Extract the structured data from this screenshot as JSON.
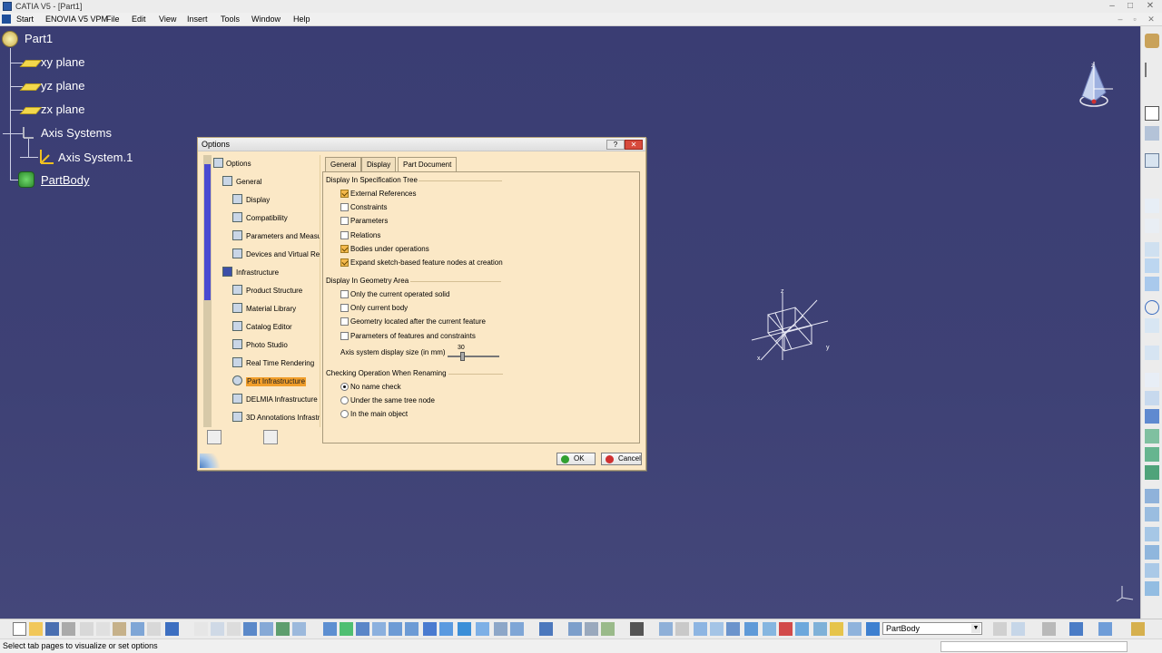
{
  "window": {
    "title": "CATIA V5 - [Part1]",
    "controls": [
      "–",
      "□",
      "✕"
    ]
  },
  "menu": [
    "Start",
    "ENOVIA V5 VPM",
    "File",
    "Edit",
    "View",
    "Insert",
    "Tools",
    "Window",
    "Help"
  ],
  "tree": {
    "root": "Part1",
    "xy_plane": "xy plane",
    "yz_plane": "yz plane",
    "zx_plane": "zx plane",
    "axis_systems": "Axis Systems",
    "axis_system_1": "Axis System.1",
    "part_body": "PartBody"
  },
  "dialog": {
    "title": "Options",
    "help_btn": "?",
    "close_btn": "✕",
    "tree": {
      "options": "Options",
      "general": "General",
      "display": "Display",
      "compatibility": "Compatibility",
      "parameters_measure": "Parameters and Measure",
      "devices": "Devices and Virtual Real",
      "infrastructure": "Infrastructure",
      "product_structure": "Product Structure",
      "material_library": "Material Library",
      "catalog_editor": "Catalog Editor",
      "photo_studio": "Photo Studio",
      "real_time_rendering": "Real Time Rendering",
      "part_infrastructure": "Part Infrastructure",
      "delmia": "DELMIA Infrastructure",
      "annotations_3d": "3D Annotations Infrastr"
    },
    "tabs": [
      "General",
      "Display",
      "Part Document"
    ],
    "spec_tree": {
      "title": "Display In Specification Tree",
      "external_references": "External References",
      "constraints": "Constraints",
      "parameters": "Parameters",
      "relations": "Relations",
      "bodies_under_operations": "Bodies under operations",
      "expand_sketch": "Expand sketch-based feature nodes at creation"
    },
    "geometry_area": {
      "title": "Display In Geometry Area",
      "only_current_operated_solid": "Only the current operated solid",
      "only_current_body": "Only current body",
      "geometry_after_feature": "Geometry located after the current feature",
      "params_features_constraints": "Parameters of features and constraints",
      "axis_size_label": "Axis system display size (in mm)",
      "axis_size_value": "30"
    },
    "renaming": {
      "title": "Checking Operation When Renaming",
      "no_name_check": "No name check",
      "same_tree_node": "Under the same tree node",
      "main_object": "In the main object"
    },
    "ok": "OK",
    "cancel": "Cancel"
  },
  "checkbox_state": {
    "external_references": true,
    "constraints": false,
    "parameters": false,
    "relations": false,
    "bodies_under_operations": true,
    "expand_sketch": true,
    "only_current_operated_solid": false,
    "only_current_body": false,
    "geometry_after_feature": false,
    "params_features_constraints": false,
    "renaming_selected": "no_name_check"
  },
  "axis_labels": {
    "x": "x",
    "y": "y",
    "z": "z"
  },
  "toolbar": {
    "current_body": "PartBody"
  },
  "status": {
    "message": "Select tab pages to visualize or set options"
  },
  "colors": {
    "viewport": "#3c3f72",
    "dialog_bg": "#fbe8c6",
    "selection": "#f19e2a",
    "tree_text": "#ffffff"
  }
}
